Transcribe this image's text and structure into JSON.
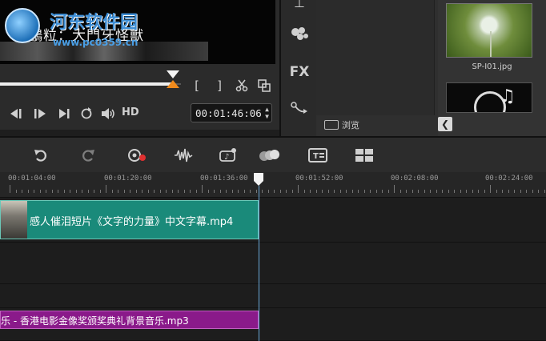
{
  "preview": {
    "subtitle": "鵬粒：大門牙怪獸",
    "watermark": {
      "site_name": "河东软件园",
      "url": "www.pc0359.cn"
    },
    "timecode": "00:01:46:06",
    "hd_label": "HD",
    "progress_fraction": 0.63,
    "controls": {
      "mark_in": "[",
      "mark_out": "]",
      "cut_icon": "scissors-icon",
      "copy_icon": "copy-icon",
      "prev_icon": "prev-clip-icon",
      "step_back_icon": "step-back-icon",
      "play_icon": "play-icon",
      "repeat_icon": "repeat-icon",
      "volume_icon": "volume-icon"
    }
  },
  "toolstrip": {
    "fx_label": "FX",
    "icons": [
      "title-icon",
      "graphic-icon",
      "fx-icon",
      "path-icon"
    ]
  },
  "library": {
    "browse_label": "浏览",
    "thumbnails": [
      {
        "label": "SP-I01.jpg",
        "icon": "dandelion-image"
      },
      {
        "label": "",
        "icon": "music-disc-image"
      }
    ]
  },
  "timeline": {
    "toolbar_icons": [
      "undo-icon",
      "redo-icon",
      "record-capture-icon",
      "sound-mixer-icon",
      "auto-music-icon",
      "motion-tracking-icon",
      "subtitle-editor-icon",
      "multi-camera-icon"
    ],
    "ruler_labels": [
      "00:01:04:00",
      "00:01:20:00",
      "00:01:36:00",
      "00:01:52:00",
      "00:02:08:00",
      "00:02:24:00"
    ],
    "video_clip": "感人催泪短片《文字的力量》中文字幕.mp4",
    "audio_clip": "乐 - 香港电影金像奖颁奖典礼背景音乐.mp3"
  }
}
